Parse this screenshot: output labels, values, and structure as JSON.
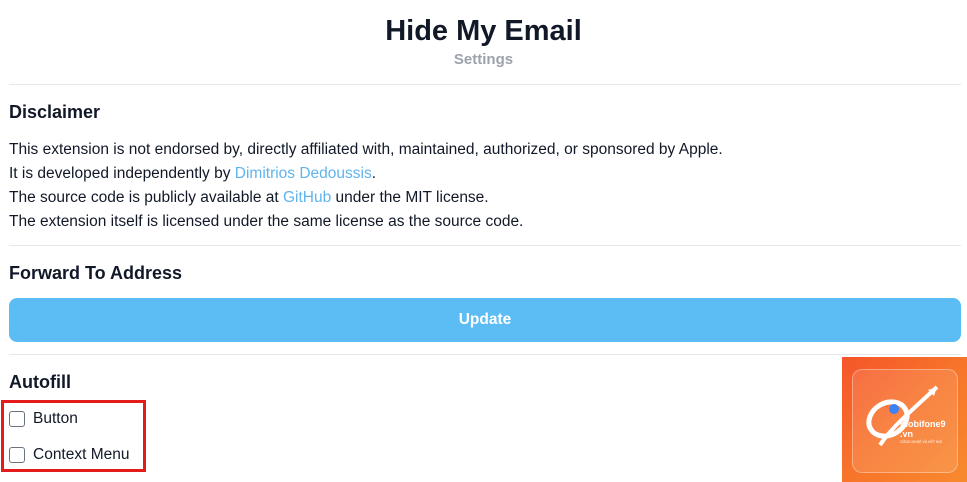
{
  "header": {
    "title": "Hide My Email",
    "subtitle": "Settings"
  },
  "disclaimer": {
    "heading": "Disclaimer",
    "line1": "This extension is not endorsed by, directly affiliated with, maintained, authorized, or sponsored by Apple.",
    "line2_prefix": "It is developed independently by ",
    "line2_link": "Dimitrios Dedoussis",
    "line2_suffix": ".",
    "line3_prefix": "The source code is publicly available at ",
    "line3_link": "GitHub",
    "line3_suffix": " under the MIT license.",
    "line4": "The extension itself is licensed under the same license as the source code."
  },
  "forward": {
    "heading": "Forward To Address",
    "update_label": "Update"
  },
  "autofill": {
    "heading": "Autofill",
    "options": [
      {
        "label": "Button",
        "checked": false
      },
      {
        "label": "Context Menu",
        "checked": false
      }
    ]
  },
  "promo": {
    "brand": "mobifone9",
    "domain": ".vn",
    "tagline": "CÔNG NGHỆ VÀ KẾT NỐI"
  },
  "colors": {
    "link": "#60b4ee",
    "button": "#5bbdf4",
    "highlight": "#e31b1b",
    "promo": "#f7742a"
  }
}
